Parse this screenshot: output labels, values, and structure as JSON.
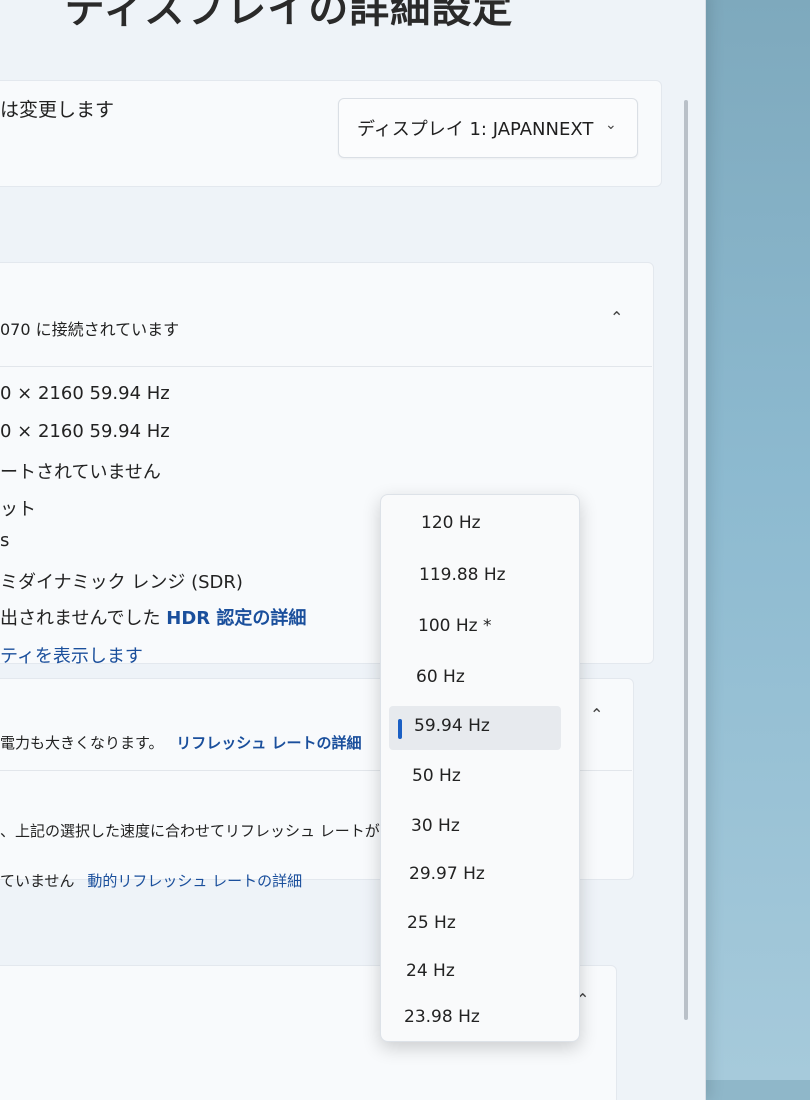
{
  "page": {
    "title": "ディスプレイの詳細設定"
  },
  "select_display": {
    "label": "は変更します",
    "value": "ディスプレイ 1: JAPANNEXT"
  },
  "display_info": {
    "connected": "070 に接続されています",
    "rows": [
      "0 × 2160 59.94 Hz",
      "0 × 2160 59.94 Hz",
      "ートされていません",
      "ット",
      "s",
      "ミダイナミック レンジ (SDR)"
    ],
    "hdr_text": "出されませんでした",
    "hdr_link": "HDR 認定の詳細",
    "properties_link": "ティを表示します"
  },
  "refresh": {
    "desc": "電力も大きくなります。",
    "link": "リフレッシュ レートの詳細",
    "dynamic_desc": "、上記の選択した速度に合わせてリフレッシュ レートが調",
    "dynamic_status": "ていません",
    "dynamic_link": "動的リフレッシュ レートの詳細"
  },
  "dropdown": {
    "options": [
      "120 Hz",
      "119.88 Hz",
      "100 Hz *",
      "60 Hz",
      "59.94 Hz",
      "50 Hz",
      "30 Hz",
      "29.97 Hz",
      "25 Hz",
      "24 Hz",
      "23.98 Hz"
    ],
    "selected": "59.94 Hz"
  },
  "icons": {
    "chevron_down": "chevron-down-icon",
    "chevron_up": "chevron-up-icon"
  }
}
